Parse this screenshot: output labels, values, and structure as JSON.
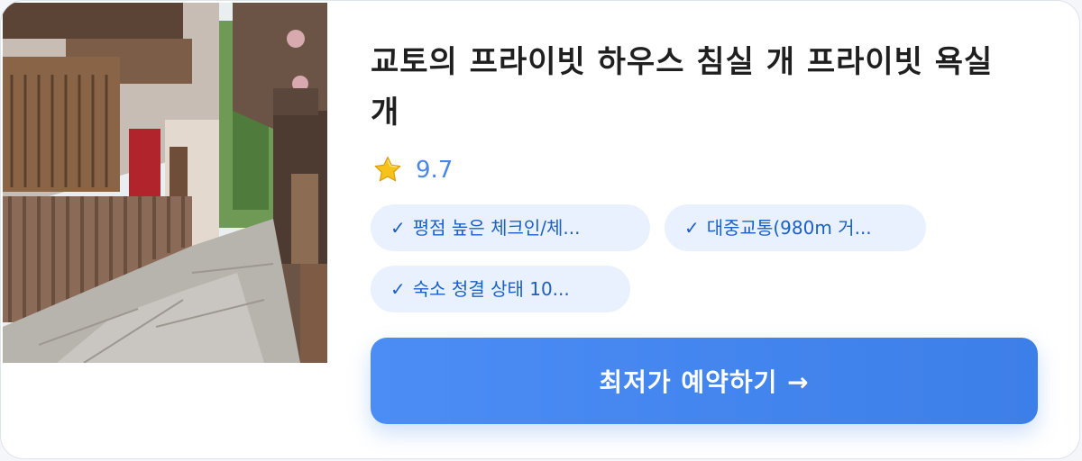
{
  "listing": {
    "title": "교토의 프라이빗 하우스 침실 개 프라이빗 욕실 개",
    "rating": "9.7",
    "star_icon": "star-icon",
    "features": [
      {
        "check": "✓",
        "text": "평점 높은 체크인/체..."
      },
      {
        "check": "✓",
        "text": "대중교통(980m 거..."
      },
      {
        "check": "✓",
        "text": "숙소 청결 상태 10..."
      }
    ],
    "cta_label": "최저가 예약하기 →"
  },
  "colors": {
    "accent": "#4a86e8",
    "tag_bg": "#e8f1fd",
    "tag_text": "#1b5fc8",
    "button": "#4b8df5"
  }
}
